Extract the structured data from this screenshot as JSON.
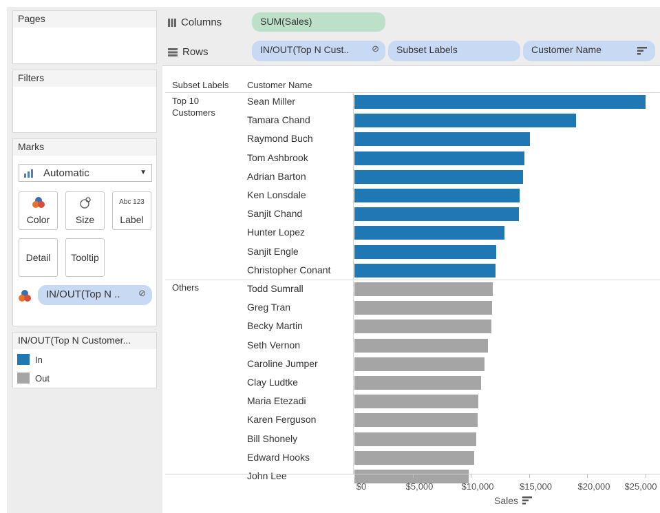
{
  "cards": {
    "pages_title": "Pages",
    "filters_title": "Filters",
    "marks_title": "Marks",
    "mark_type": "Automatic",
    "buttons": {
      "color": "Color",
      "size": "Size",
      "label": "Label",
      "detail": "Detail",
      "tooltip": "Tooltip"
    },
    "label_icon_text": "Abc 123",
    "color_pill": "IN/OUT(Top N ..",
    "legend_title": "IN/OUT(Top N Customer...",
    "legend_items": [
      {
        "label": "In",
        "color": "#1f77b4"
      },
      {
        "label": "Out",
        "color": "#a5a5a5"
      }
    ]
  },
  "shelves": {
    "columns_label": "Columns",
    "rows_label": "Rows",
    "columns_pill": "SUM(Sales)",
    "rows_pills": [
      "IN/OUT(Top N Cust..",
      "Subset Labels",
      "Customer Name"
    ]
  },
  "headers": {
    "subset": "Subset Labels",
    "customer": "Customer Name"
  },
  "groups": {
    "top": "Top 10 Customers",
    "others": "Others"
  },
  "colors": {
    "in": "#1f77b4",
    "out": "#a5a5a5",
    "columns_pill": "#bde0c8",
    "rows_pill": "#c8d9f3"
  },
  "chart_data": {
    "type": "bar",
    "orientation": "horizontal",
    "xlabel": "Sales",
    "xlim": [
      0,
      26000
    ],
    "xticks": [
      "$0",
      "$5,000",
      "$10,000",
      "$15,000",
      "$20,000",
      "$25,000"
    ],
    "categories": [
      "Sean Miller",
      "Tamara Chand",
      "Raymond Buch",
      "Tom Ashbrook",
      "Adrian Barton",
      "Ken Lonsdale",
      "Sanjit Chand",
      "Hunter Lopez",
      "Sanjit Engle",
      "Christopher Conant",
      "Todd Sumrall",
      "Greg Tran",
      "Becky Martin",
      "Seth Vernon",
      "Caroline Jumper",
      "Clay Ludtke",
      "Maria Etezadi",
      "Karen Ferguson",
      "Bill Shonely",
      "Edward Hooks",
      "John Lee"
    ],
    "values": [
      25043,
      19052,
      15117,
      14596,
      14474,
      14175,
      14142,
      12873,
      12209,
      12129,
      11892,
      11820,
      11790,
      11471,
      11165,
      10880,
      10663,
      10605,
      10502,
      10311,
      9800
    ],
    "groups": [
      "In",
      "In",
      "In",
      "In",
      "In",
      "In",
      "In",
      "In",
      "In",
      "In",
      "Out",
      "Out",
      "Out",
      "Out",
      "Out",
      "Out",
      "Out",
      "Out",
      "Out",
      "Out",
      "Out"
    ]
  }
}
